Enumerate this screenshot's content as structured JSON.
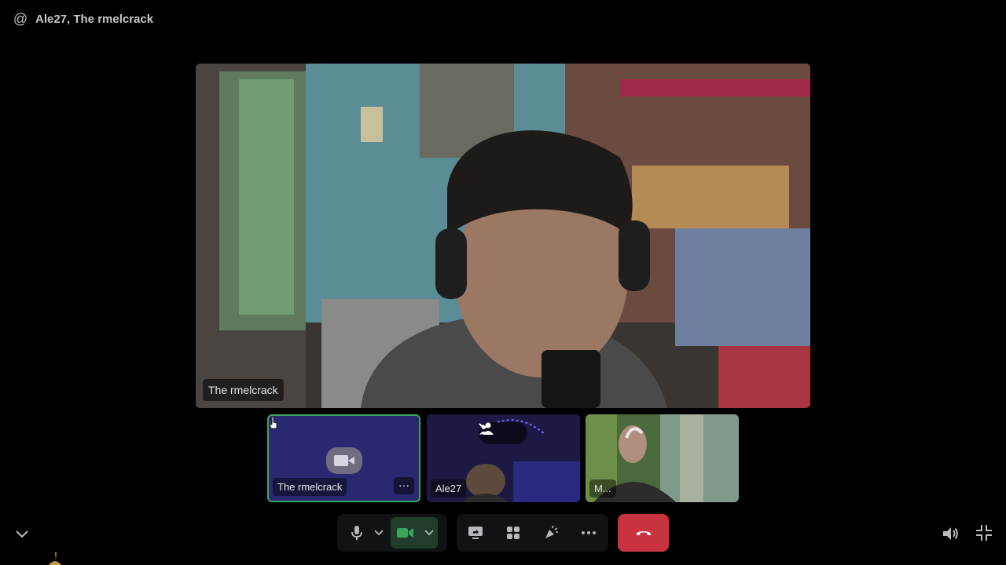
{
  "header": {
    "icon": "at-icon",
    "title": "Ale27, The rmelcrack"
  },
  "stage": {
    "participant_name": "The rmelcrack"
  },
  "tiles": [
    {
      "name": "The rmelcrack",
      "state": "camera-off",
      "icon": "video-camera-icon",
      "more_label": "···"
    },
    {
      "name": "Ale27",
      "overlay_icons": [
        "chevron-down-icon",
        "people-icon"
      ]
    },
    {
      "name": "M..."
    }
  ],
  "controls": {
    "mic": "microphone-icon",
    "mic_options": "chevron-down-icon",
    "camera": "video-camera-icon",
    "camera_options": "chevron-down-icon",
    "screen_share": "screen-share-icon",
    "activities": "activities-icon",
    "soundboard": "soundboard-icon",
    "more": "ellipsis-icon",
    "leave": "hang-up-icon"
  },
  "colors": {
    "background": "#000000",
    "speaking_border": "#3ba55d",
    "leave_button": "#c8333f",
    "camera_active_bg": "#1f3d2a",
    "camera_active_icon": "#3ba55d"
  }
}
